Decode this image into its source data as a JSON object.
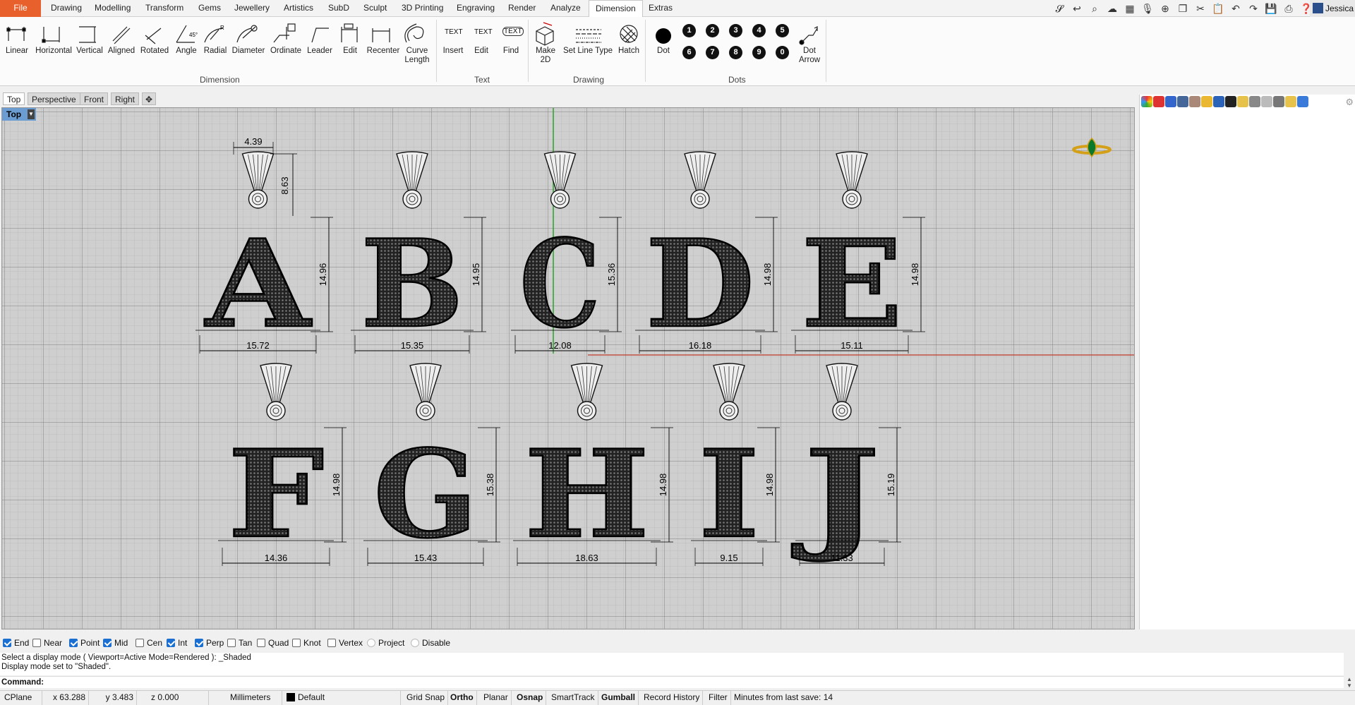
{
  "menu": {
    "file": "File",
    "items": [
      "Drawing",
      "Modelling",
      "Transform",
      "Gems",
      "Jewellery",
      "Artistics",
      "SubD",
      "Sculpt",
      "3D Printing",
      "Engraving",
      "Render",
      "Analyze",
      "Dimension",
      "Extras"
    ],
    "active": "Dimension",
    "user": "Jessica"
  },
  "ribbon": {
    "dimension_buttons": [
      "Linear",
      "Horizontal",
      "Vertical",
      "Aligned",
      "Rotated",
      "Angle",
      "Radial",
      "Diameter",
      "Ordinate",
      "Leader",
      "Edit",
      "Recenter",
      "Curve Length"
    ],
    "text_buttons": [
      "Insert",
      "Edit",
      "Find"
    ],
    "drawing_buttons": [
      "Make 2D",
      "Set Line Type",
      "Hatch"
    ],
    "dots_buttons": [
      "Dot",
      "Dot Arrow"
    ],
    "dot_numbers": [
      "1",
      "2",
      "3",
      "4",
      "5",
      "6",
      "7",
      "8",
      "9",
      "0"
    ],
    "icon_text": {
      "insert": "TEXT",
      "edit": "TEXT",
      "find": "TEXT"
    },
    "groups": {
      "dimension": "Dimension",
      "text": "Text",
      "drawing": "Drawing",
      "dots": "Dots"
    }
  },
  "viewport_tabs": [
    "Top",
    "Perspective",
    "Front",
    "Right"
  ],
  "active_viewport": "Top",
  "drawing": {
    "letters_row1": [
      "A",
      "B",
      "C",
      "D",
      "E"
    ],
    "letters_row2": [
      "F",
      "G",
      "H",
      "I",
      "J"
    ],
    "widths_row1": [
      "15.72",
      "15.35",
      "12.08",
      "16.18",
      "15.11"
    ],
    "heights_row1": [
      "14.96",
      "14.95",
      "15.36",
      "14.98",
      "14.98"
    ],
    "widths_row2": [
      "14.36",
      "15.43",
      "18.63",
      "9.15",
      "11.33"
    ],
    "heights_row2": [
      "14.98",
      "15.38",
      "14.98",
      "14.98",
      "15.19"
    ],
    "bail_width": "4.39",
    "bail_height": "8.63"
  },
  "osnap": [
    {
      "label": "End",
      "checked": true
    },
    {
      "label": "Near",
      "checked": false
    },
    {
      "label": "Point",
      "checked": true
    },
    {
      "label": "Mid",
      "checked": true
    },
    {
      "label": "Cen",
      "checked": false
    },
    {
      "label": "Int",
      "checked": true
    },
    {
      "label": "Perp",
      "checked": true
    },
    {
      "label": "Tan",
      "checked": false
    },
    {
      "label": "Quad",
      "checked": false
    },
    {
      "label": "Knot",
      "checked": false
    },
    {
      "label": "Vertex",
      "checked": false
    },
    {
      "label": "Project",
      "checked": false
    },
    {
      "label": "Disable",
      "checked": false
    }
  ],
  "command_history": [
    "Select a display mode ( Viewport=Active  Mode=Rendered ): _Shaded",
    "Display mode set to \"Shaded\"."
  ],
  "command_prompt": "Command:",
  "status": {
    "cplane": "CPlane",
    "x": "x 63.288",
    "y": "y 3.483",
    "z": "z 0.000",
    "units": "Millimeters",
    "layer": "Default",
    "grid_snap": "Grid Snap",
    "ortho": "Ortho",
    "planar": "Planar",
    "osnap": "Osnap",
    "smarttrack": "SmartTrack",
    "gumball": "Gumball",
    "record_history": "Record History",
    "filter": "Filter",
    "last_save": "Minutes from last save: 14"
  },
  "colors": {
    "file_tab": "#e8612c",
    "vp_label": "#6b9dd3",
    "check": "#1a6fd0",
    "axis_green": "#2ca02c",
    "axis_red": "#c0392b"
  }
}
